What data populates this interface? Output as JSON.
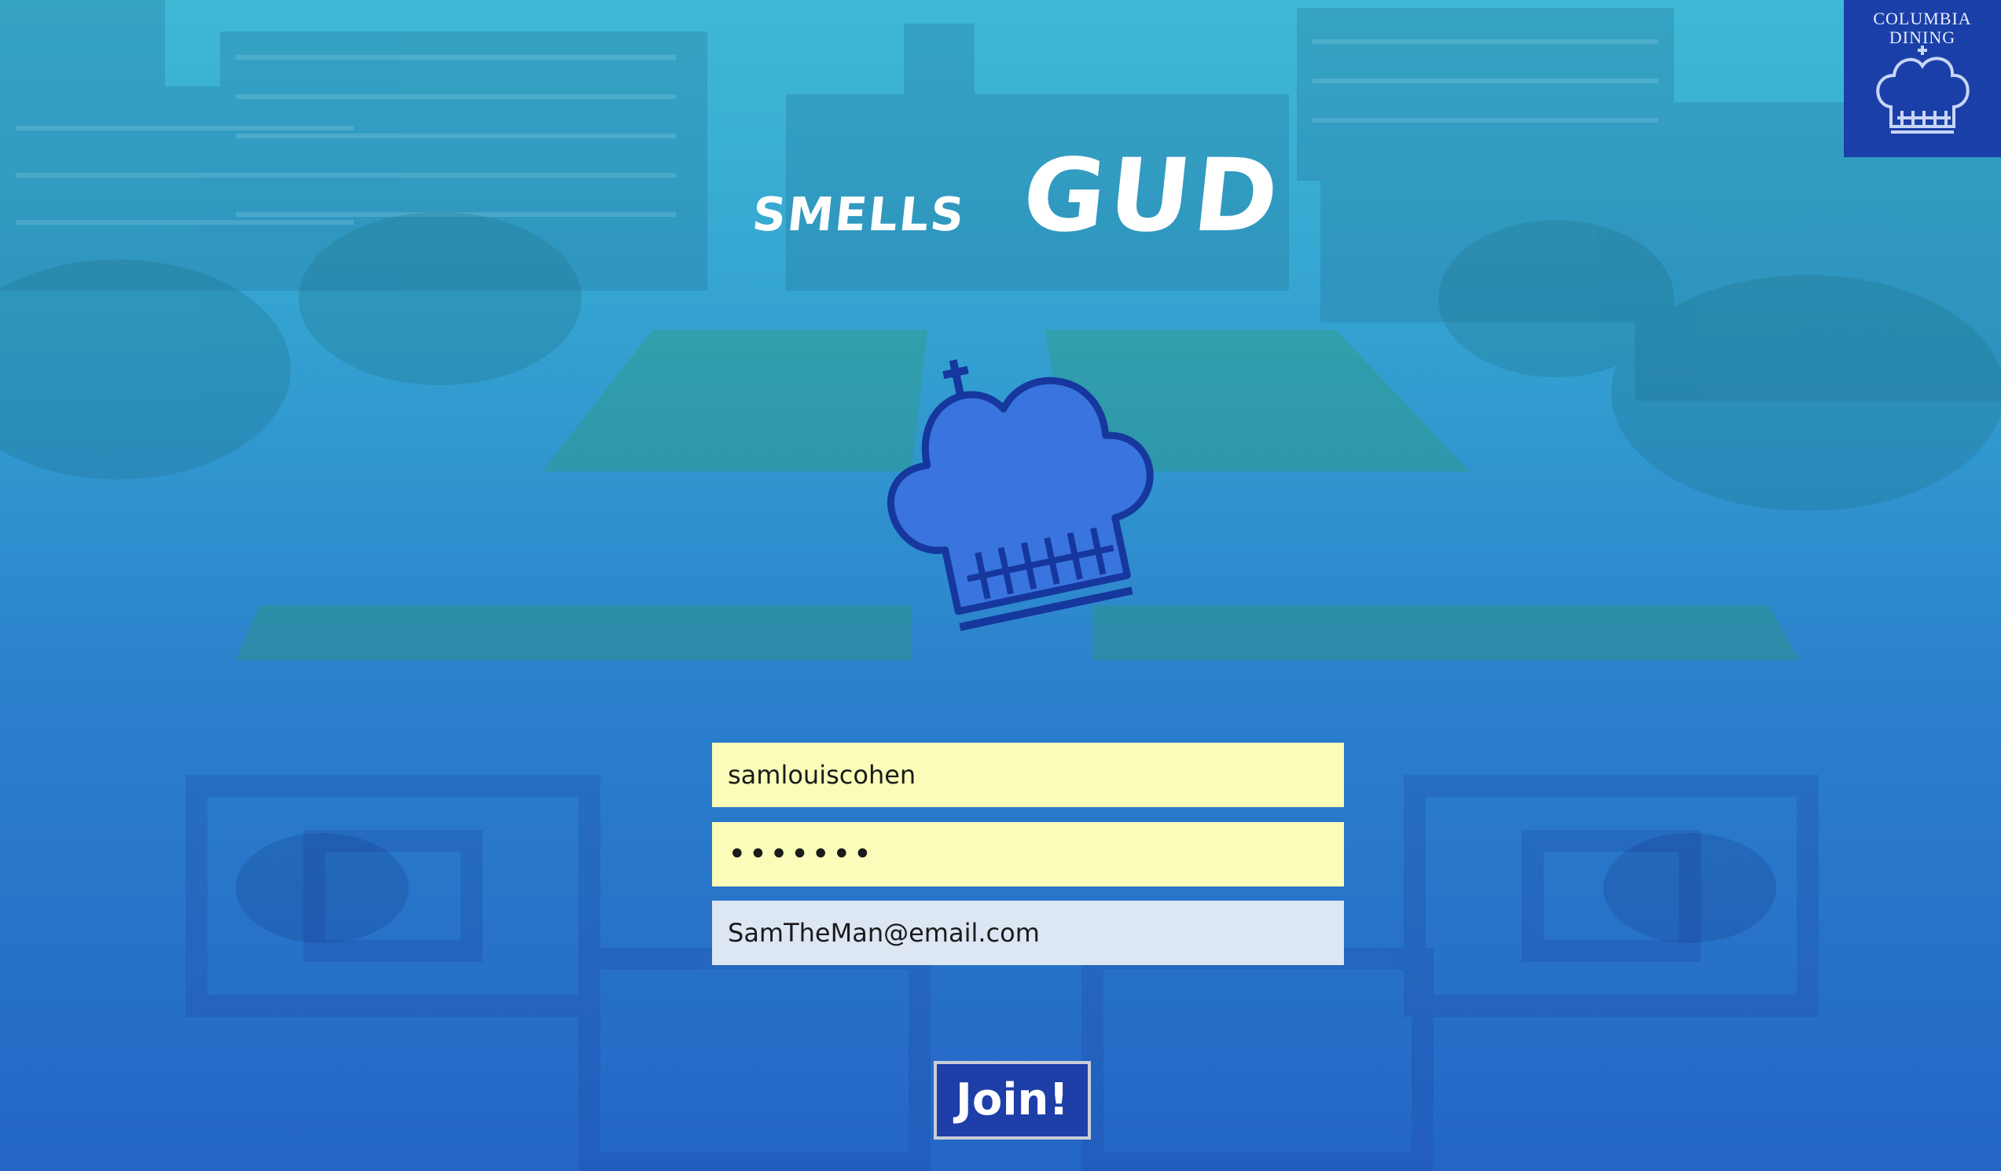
{
  "brand": {
    "name_part1": "smells",
    "name_part2": "GUD"
  },
  "corner_logo": {
    "line1": "COLUMBIA",
    "line2": "DINING",
    "icon": "chef-hat-icon"
  },
  "form": {
    "username_value": "samlouiscohen",
    "password_value": "•••••••",
    "email_value": "SamTheMan@email.com",
    "join_label": "Join!"
  },
  "colors": {
    "field_filled": "#fafcb9",
    "field_email": "#dde6f3",
    "button": "#1e3ea8",
    "hat": "#3a74de",
    "hat_outline": "#16379e"
  }
}
